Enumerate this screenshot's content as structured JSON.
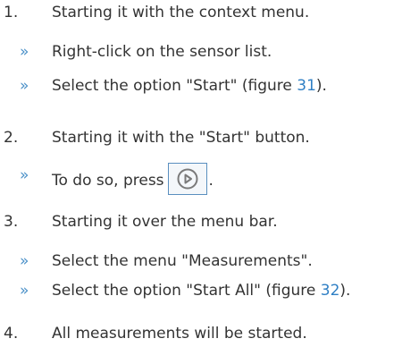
{
  "steps": [
    {
      "number": "1.",
      "text": "Starting it with the context menu.",
      "subitems": [
        {
          "bullet": "»",
          "text": "Right-click on the sensor list."
        },
        {
          "bullet": "»",
          "text_before": "Select the option \"Start\" (figure ",
          "link": "31",
          "text_after": ")."
        }
      ]
    },
    {
      "number": "2.",
      "text": "Starting it with the \"Start\" button.",
      "subitems": [
        {
          "bullet": "»",
          "text_before": "To do so, press",
          "icon": "play-circle-icon",
          "text_after": "."
        }
      ]
    },
    {
      "number": "3.",
      "text": "Starting it over the menu bar.",
      "subitems": [
        {
          "bullet": "»",
          "text": "Select the menu \"Measurements\"."
        },
        {
          "bullet": "»",
          "text_before": "Select the option \"Start All\" (figure ",
          "link": "32",
          "text_after": ")."
        }
      ]
    },
    {
      "number": "4.",
      "text": "All measurements will be started."
    }
  ],
  "colors": {
    "text": "#333333",
    "bullet": "#4a90c8",
    "link": "#2f7fc4",
    "button_border": "#5a8fbf",
    "icon": "#7a7a7a"
  }
}
